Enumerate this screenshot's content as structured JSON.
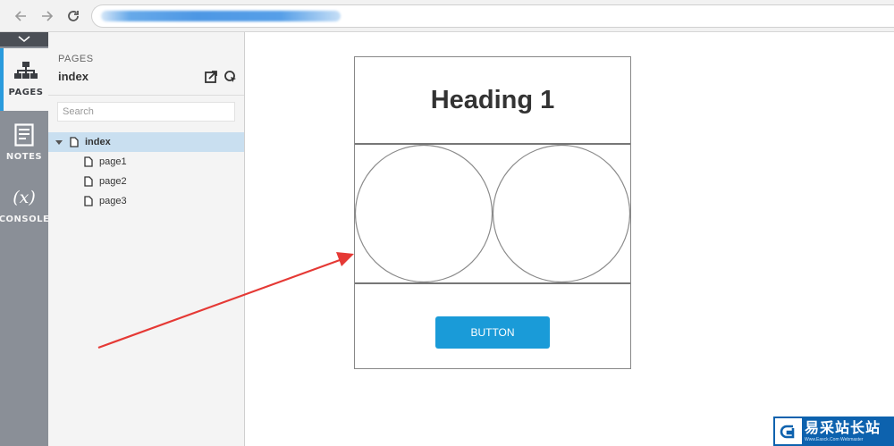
{
  "browser": {
    "address_value": ""
  },
  "rail": {
    "items": [
      {
        "label": "PAGES",
        "icon": "sitemap-icon",
        "active": true
      },
      {
        "label": "NOTES",
        "icon": "notes-icon",
        "active": false
      },
      {
        "label": "CONSOLE",
        "icon": "variable-x-icon",
        "glyph": "(x)",
        "active": false
      }
    ]
  },
  "pages_panel": {
    "title": "PAGES",
    "current_page": "index",
    "search_placeholder": "Search",
    "tree": [
      {
        "label": "index",
        "selected": true,
        "expanded": true
      },
      {
        "label": "page1",
        "selected": false
      },
      {
        "label": "page2",
        "selected": false
      },
      {
        "label": "page3",
        "selected": false
      }
    ]
  },
  "canvas": {
    "heading": "Heading 1",
    "button_label": "BUTTON"
  },
  "watermark": {
    "name": "易采站长站",
    "subtitle": "Www.Easck.Com Webmaster"
  },
  "colors": {
    "accent": "#2a9bdd",
    "button": "#1a9bd8",
    "rail": "#8a8f97",
    "annotation_arrow": "#e53935",
    "watermark": "#0d62ae"
  }
}
